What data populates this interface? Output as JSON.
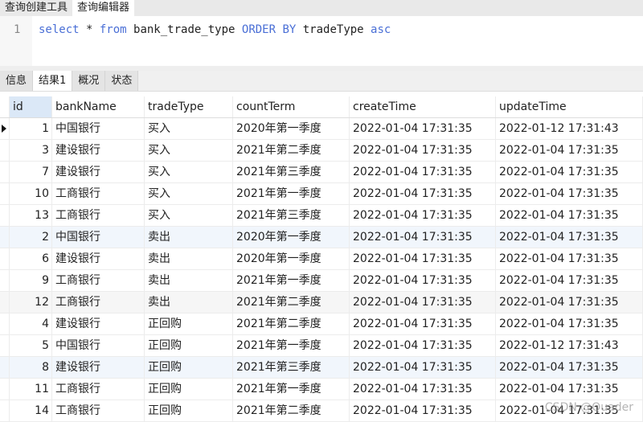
{
  "top_tabs": [
    "查询创建工具",
    "查询编辑器"
  ],
  "editor": {
    "line": "1",
    "tokens": [
      {
        "t": "select",
        "kw": true
      },
      {
        "t": " * ",
        "kw": false
      },
      {
        "t": "from",
        "kw": true
      },
      {
        "t": " bank_trade_type ",
        "kw": false
      },
      {
        "t": "ORDER BY",
        "kw": true
      },
      {
        "t": " tradeType ",
        "kw": false
      },
      {
        "t": "asc",
        "kw": true
      }
    ]
  },
  "result_tabs": [
    "信息",
    "结果1",
    "概况",
    "状态"
  ],
  "columns": [
    "id",
    "bankName",
    "tradeType",
    "countTerm",
    "createTime",
    "updateTime"
  ],
  "rows": [
    [
      "1",
      "中国银行",
      "买入",
      "2020年第一季度",
      "2022-01-04 17:31:35",
      "2022-01-12 17:31:43"
    ],
    [
      "3",
      "建设银行",
      "买入",
      "2021年第二季度",
      "2022-01-04 17:31:35",
      "2022-01-04 17:31:35"
    ],
    [
      "7",
      "建设银行",
      "买入",
      "2021年第三季度",
      "2022-01-04 17:31:35",
      "2022-01-04 17:31:35"
    ],
    [
      "10",
      "工商银行",
      "买入",
      "2021年第一季度",
      "2022-01-04 17:31:35",
      "2022-01-04 17:31:35"
    ],
    [
      "13",
      "工商银行",
      "买入",
      "2021年第三季度",
      "2022-01-04 17:31:35",
      "2022-01-04 17:31:35"
    ],
    [
      "2",
      "中国银行",
      "卖出",
      "2020年第一季度",
      "2022-01-04 17:31:35",
      "2022-01-04 17:31:35"
    ],
    [
      "6",
      "建设银行",
      "卖出",
      "2020年第一季度",
      "2022-01-04 17:31:35",
      "2022-01-04 17:31:35"
    ],
    [
      "9",
      "工商银行",
      "卖出",
      "2021年第一季度",
      "2022-01-04 17:31:35",
      "2022-01-04 17:31:35"
    ],
    [
      "12",
      "工商银行",
      "卖出",
      "2021年第二季度",
      "2022-01-04 17:31:35",
      "2022-01-04 17:31:35"
    ],
    [
      "4",
      "建设银行",
      "正回购",
      "2021年第二季度",
      "2022-01-04 17:31:35",
      "2022-01-04 17:31:35"
    ],
    [
      "5",
      "中国银行",
      "正回购",
      "2021年第一季度",
      "2022-01-04 17:31:35",
      "2022-01-12 17:31:43"
    ],
    [
      "8",
      "建设银行",
      "正回购",
      "2021年第三季度",
      "2022-01-04 17:31:35",
      "2022-01-04 17:31:35"
    ],
    [
      "11",
      "工商银行",
      "正回购",
      "2021年第一季度",
      "2022-01-04 17:31:35",
      "2022-01-04 17:31:35"
    ],
    [
      "14",
      "工商银行",
      "正回购",
      "2021年第二季度",
      "2022-01-04 17:31:35",
      "2022-01-04 17:31:35"
    ]
  ],
  "watermark": "CSDN @Quader"
}
